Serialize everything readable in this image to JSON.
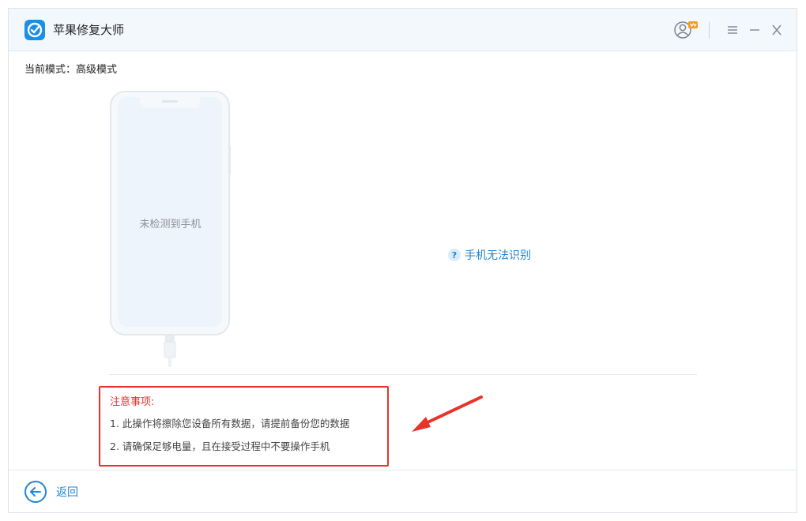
{
  "app": {
    "title": "苹果修复大师"
  },
  "mode": {
    "text": "当前模式：高级模式"
  },
  "device": {
    "status": "未检测到手机"
  },
  "help": {
    "label": "手机无法识别"
  },
  "notice": {
    "title": "注意事项:",
    "items": [
      "1. 此操作将擦除您设备所有数据，请提前备份您的数据",
      "2. 请确保足够电量，且在接受过程中不要操作手机"
    ]
  },
  "footer": {
    "back_label": "返回"
  },
  "colors": {
    "accent": "#1f86d8",
    "annotation": "#e8332a",
    "logo": "#1b8fe8"
  },
  "icons": [
    "app-logo-icon",
    "user-account-icon",
    "menu-icon",
    "minimize-icon",
    "close-icon",
    "help-icon",
    "back-arrow-icon"
  ]
}
